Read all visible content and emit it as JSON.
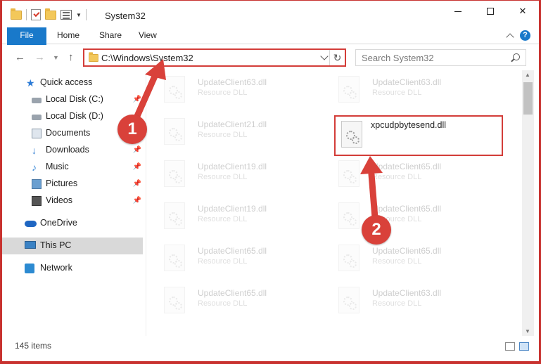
{
  "window": {
    "title": "System32",
    "min_glyph": "—",
    "max_glyph": "☐",
    "close_glyph": "✕"
  },
  "ribbon": {
    "tabs": [
      "File",
      "Home",
      "Share",
      "View"
    ],
    "help_label": "?"
  },
  "nav": {
    "back": "←",
    "forward": "→",
    "up": "↑",
    "refresh": "↻",
    "address": "C:\\Windows\\System32",
    "search_placeholder": "Search System32"
  },
  "sidebar": {
    "items": [
      {
        "label": "Quick access",
        "icon": "star-icon",
        "pinned": false
      },
      {
        "label": "Local Disk (C:)",
        "icon": "disk-icon",
        "pinned": true
      },
      {
        "label": "Local Disk (D:)",
        "icon": "disk-icon",
        "pinned": false
      },
      {
        "label": "Documents",
        "icon": "documents-icon",
        "pinned": false
      },
      {
        "label": "Downloads",
        "icon": "download-icon",
        "pinned": true
      },
      {
        "label": "Music",
        "icon": "music-icon",
        "pinned": true
      },
      {
        "label": "Pictures",
        "icon": "pictures-icon",
        "pinned": true
      },
      {
        "label": "Videos",
        "icon": "videos-icon",
        "pinned": true
      },
      {
        "label": "OneDrive",
        "icon": "cloud-icon",
        "pinned": false
      },
      {
        "label": "This PC",
        "icon": "pc-icon",
        "pinned": false,
        "selected": true
      },
      {
        "label": "Network",
        "icon": "network-icon",
        "pinned": false
      }
    ],
    "pin_glyph": "📌"
  },
  "files": [
    {
      "name": "UpdateClient63.dll",
      "desc": "Resource DLL",
      "dim": true
    },
    {
      "name": "UpdateClient63.dll",
      "desc": "Resource DLL",
      "dim": true
    },
    {
      "name": "UpdateClient21.dll",
      "desc": "Resource DLL",
      "dim": true
    },
    {
      "name": "xpcudpbytesend.dll",
      "desc": "",
      "dim": false,
      "highlighted": true
    },
    {
      "name": "UpdateClient19.dll",
      "desc": "Resource DLL",
      "dim": true
    },
    {
      "name": "UpdateClient65.dll",
      "desc": "Resource DLL",
      "dim": true
    },
    {
      "name": "UpdateClient19.dll",
      "desc": "Resource DLL",
      "dim": true
    },
    {
      "name": "UpdateClient65.dll",
      "desc": "Resource DLL",
      "dim": true
    },
    {
      "name": "UpdateClient65.dll",
      "desc": "Resource DLL",
      "dim": true
    },
    {
      "name": "UpdateClient65.dll",
      "desc": "Resource DLL",
      "dim": true
    },
    {
      "name": "UpdateClient65.dll",
      "desc": "Resource DLL",
      "dim": true
    },
    {
      "name": "UpdateClient63.dll",
      "desc": "Resource DLL",
      "dim": true
    }
  ],
  "status": {
    "item_count": "145 items"
  },
  "annotations": {
    "step1": "1",
    "step2": "2",
    "color": "#d9413a"
  }
}
